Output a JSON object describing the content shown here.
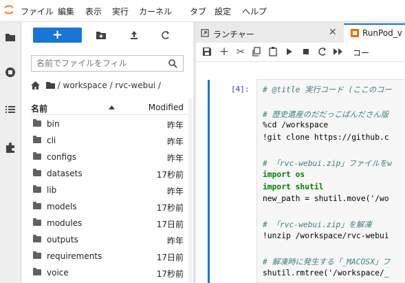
{
  "menubar": {
    "items": [
      "ファイル",
      "編集",
      "表示",
      "実行",
      "カーネル",
      "タブ",
      "設定",
      "ヘルプ"
    ]
  },
  "file_browser": {
    "new_label": "+",
    "filter_placeholder": "名前でファイルをフィル",
    "breadcrumb": "/ workspace / rvc-webui /",
    "columns": {
      "name": "名前",
      "modified": "Modified"
    },
    "rows": [
      {
        "name": "bin",
        "modified": "昨年"
      },
      {
        "name": "cli",
        "modified": "昨年"
      },
      {
        "name": "configs",
        "modified": "昨年"
      },
      {
        "name": "datasets",
        "modified": "17秒前"
      },
      {
        "name": "lib",
        "modified": "昨年"
      },
      {
        "name": "models",
        "modified": "17秒前"
      },
      {
        "name": "modules",
        "modified": "17日前"
      },
      {
        "name": "outputs",
        "modified": "昨年"
      },
      {
        "name": "requirements",
        "modified": "17日前"
      },
      {
        "name": "voice",
        "modified": "17秒前"
      }
    ]
  },
  "tabs": [
    {
      "label": "ランチャー"
    },
    {
      "label": "RunPod_v"
    }
  ],
  "notebook": {
    "toolbar_cell_type": "コー",
    "prompt": "[4]:",
    "code_lines": [
      "# @title 実行コード (ここのコー",
      "",
      "# 歴史遺産のだだっこぱんださん版",
      "%cd /workspace",
      "!git clone https://github.c",
      "",
      "# 「rvc-webui.zip」ファイルをw",
      "import os",
      "import shutil",
      "new_path = shutil.move('/wo",
      "",
      "# 「rvc-webui.zip」を解凍",
      "!unzip /workspace/rvc-webui",
      "",
      "# 解凍時に発生する「_MACOSX」フ",
      "shutil.rmtree('/workspace/_"
    ]
  },
  "colors": {
    "accent": "#1976d2",
    "comment": "#408080",
    "keyword": "#008000"
  }
}
